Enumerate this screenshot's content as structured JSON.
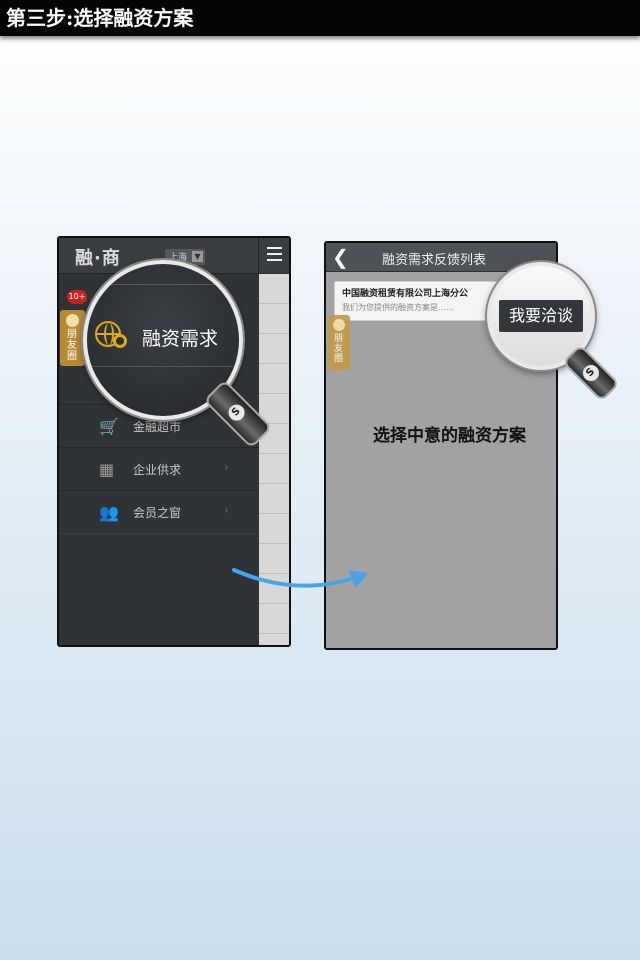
{
  "header": {
    "title": "第三步:选择融资方案"
  },
  "left_phone": {
    "logo": "融·商",
    "city": "上海",
    "badge": "10+",
    "friend_tab": "朋友圈",
    "magnified_label": "融资需求",
    "menu": [
      {
        "label": "金融超市",
        "icon": "cart-icon"
      },
      {
        "label": "企业供求",
        "icon": "barcode-icon"
      },
      {
        "label": "会员之窗",
        "icon": "people-icon"
      }
    ]
  },
  "right_phone": {
    "title": "融资需求反馈列表",
    "card_title": "中国融资租赁有限公司上海分公",
    "card_subtitle": "我们为您提供的融资方案是……",
    "friend_tab": "朋友圈",
    "magnified_button": "我要洽谈",
    "caption": "选择中意的融资方案"
  },
  "colors": {
    "accent_gold": "#e0a81e",
    "panel_dark": "#2f3336",
    "header_bar": "#050505"
  }
}
